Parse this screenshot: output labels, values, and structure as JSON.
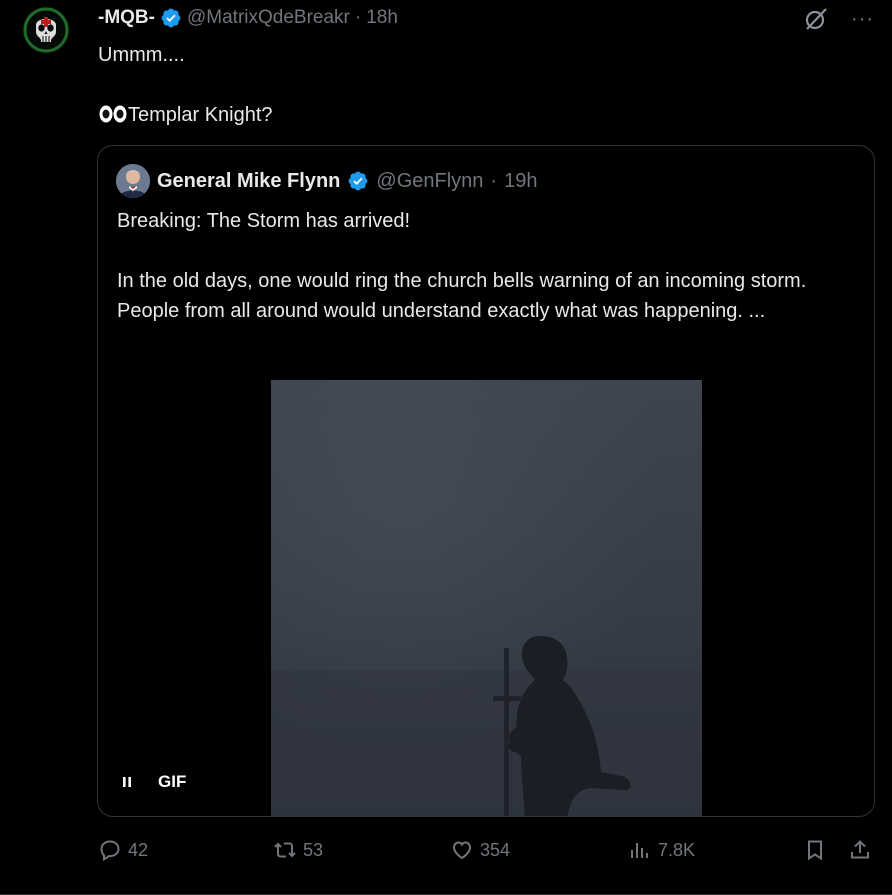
{
  "tweet": {
    "display_name": "-MQB-",
    "handle": "@MatrixQdeBreakr",
    "dot": "·",
    "time": "18h",
    "text_line1": "Ummm....",
    "text_line2": "Templar Knight?",
    "emoji_icon": "eyes-emoji-icon"
  },
  "quote": {
    "display_name": "General Mike Flynn",
    "handle": "@GenFlynn",
    "dot": "·",
    "time": "19h",
    "text": "Breaking: The Storm has arrived!\n\nIn the old days, one would ring the church bells warning of an incoming storm. People from all around would understand exactly what was happening. ...",
    "media_label": "GIF"
  },
  "actions": {
    "replies": "42",
    "reposts": "53",
    "likes": "354",
    "views": "7.8K"
  },
  "colors": {
    "background": "#000000",
    "text": "#e7e9ea",
    "muted": "#71767b",
    "verified": "#1d9bf0",
    "border": "#2f3336"
  }
}
